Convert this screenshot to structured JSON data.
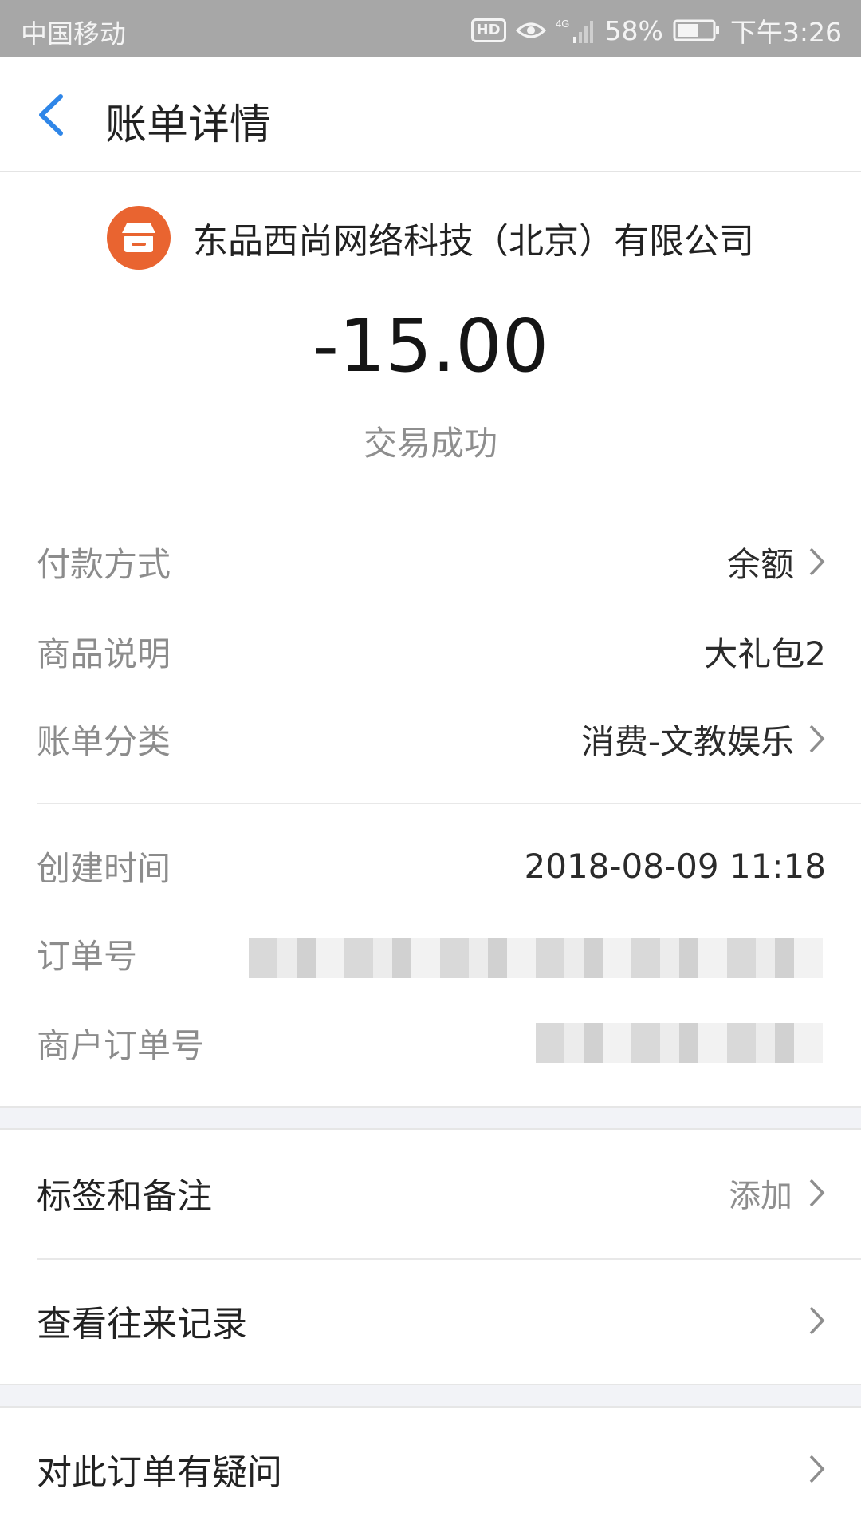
{
  "status_bar": {
    "carrier": "中国移动",
    "hd": "HD",
    "network": "4G",
    "battery": "58%",
    "time": "下午3:26"
  },
  "header": {
    "title": "账单详情"
  },
  "merchant": {
    "name": "东品西尚网络科技（北京）有限公司",
    "icon": "store-icon",
    "icon_color": "#e96430"
  },
  "transaction": {
    "amount": "-15.00",
    "status": "交易成功"
  },
  "details": [
    {
      "label": "付款方式",
      "value": "余额"
    },
    {
      "label": "商品说明",
      "value": "大礼包2"
    },
    {
      "label": "账单分类",
      "value": "消费-文教娱乐"
    },
    {
      "label": "创建时间",
      "value": "2018-08-09 11:18"
    },
    {
      "label": "订单号",
      "value": ""
    },
    {
      "label": "商户订单号",
      "value": ""
    }
  ],
  "actions": [
    {
      "label": "标签和备注",
      "value": "添加"
    },
    {
      "label": "查看往来记录",
      "value": ""
    },
    {
      "label": "对此订单有疑问",
      "value": ""
    }
  ],
  "colors": {
    "accent": "#2f86e8",
    "status_bar_bg": "#a7a7a7",
    "section_gap": "#f2f3f7"
  }
}
